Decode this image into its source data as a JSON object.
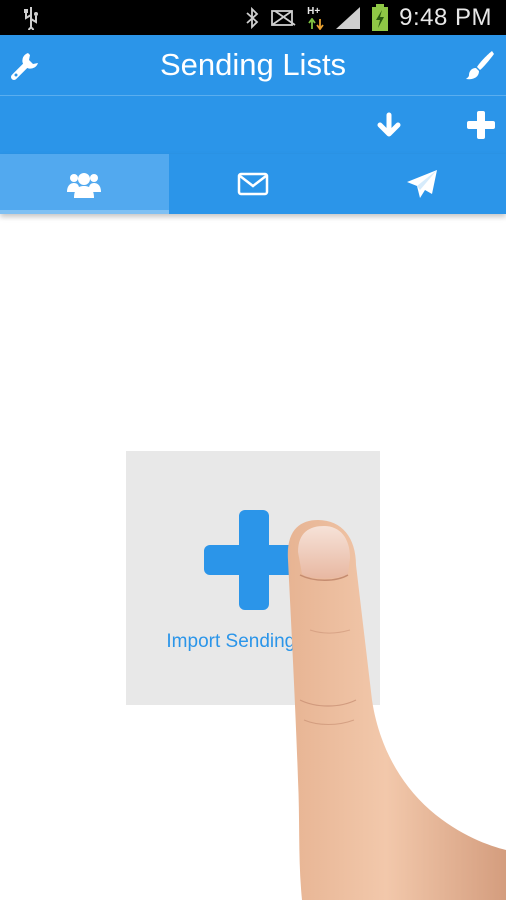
{
  "status_bar": {
    "time": "9:48 PM",
    "network": "H+",
    "icons": [
      "usb-icon",
      "bluetooth-icon",
      "mute-icon",
      "network-icon",
      "signal-icon",
      "battery-icon"
    ]
  },
  "app_bar": {
    "title": "Sending Lists",
    "left_icon": "wrench-icon",
    "right_icon": "brush-icon"
  },
  "action_bar": {
    "icons": [
      "download-icon",
      "add-icon"
    ]
  },
  "tabs": [
    {
      "name": "contacts",
      "icon": "group-icon",
      "active": true
    },
    {
      "name": "messages",
      "icon": "envelope-icon",
      "active": false
    },
    {
      "name": "send",
      "icon": "paper-plane-icon",
      "active": false
    }
  ],
  "import_card": {
    "label": "Import Sending Lists",
    "icon": "plus-icon"
  },
  "colors": {
    "primary": "#2b95e9",
    "tab_active": "#52a9ef",
    "card": "#e8e8e8",
    "status_bar": "#000000"
  }
}
